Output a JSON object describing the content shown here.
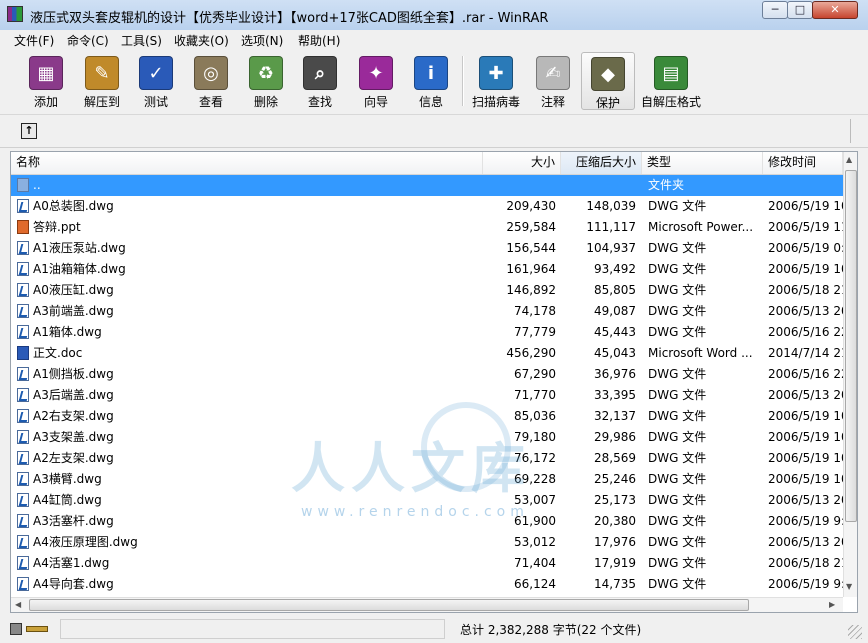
{
  "window": {
    "title": "液压式双头套皮辊机的设计【优秀毕业设计】【word+17张CAD图纸全套】.rar - WinRAR",
    "min_glyph": "─",
    "max_glyph": "□",
    "close_glyph": "✕"
  },
  "menu": [
    "文件(F)",
    "命令(C)",
    "工具(S)",
    "收藏夹(O)",
    "选项(N)",
    "帮助(H)"
  ],
  "toolbar": [
    {
      "label": "添加",
      "icon": "add-archive-icon",
      "glyph": "▦",
      "color": "#8a3a8a"
    },
    {
      "label": "解压到",
      "icon": "extract-to-icon",
      "glyph": "✎",
      "color": "#c08a2a"
    },
    {
      "label": "测试",
      "icon": "test-icon",
      "glyph": "✓",
      "color": "#2a5ab8"
    },
    {
      "label": "查看",
      "icon": "view-icon",
      "glyph": "◎",
      "color": "#8a7a5a"
    },
    {
      "label": "删除",
      "icon": "delete-icon",
      "glyph": "♻",
      "color": "#5a9a4a"
    },
    {
      "label": "查找",
      "icon": "find-icon",
      "glyph": "⌕",
      "color": "#4a4a4a"
    },
    {
      "label": "向导",
      "icon": "wizard-icon",
      "glyph": "✦",
      "color": "#9a2a9a"
    },
    {
      "label": "信息",
      "icon": "info-icon",
      "glyph": "i",
      "color": "#2a6ac8"
    },
    {
      "label": "扫描病毒",
      "icon": "scan-virus-icon",
      "glyph": "✚",
      "color": "#2a7ab8"
    },
    {
      "label": "注释",
      "icon": "comment-icon",
      "glyph": "✍",
      "color": "#b8b8b8"
    },
    {
      "label": "保护",
      "icon": "protect-icon",
      "glyph": "◆",
      "color": "#6a6a4a"
    },
    {
      "label": "自解压格式",
      "icon": "sfx-icon",
      "glyph": "▤",
      "color": "#3a8a3a"
    }
  ],
  "address": {
    "up_glyph": "↑"
  },
  "columns": {
    "name": "名称",
    "size": "大小",
    "packed": "压缩后大小",
    "type": "类型",
    "modified": "修改时间"
  },
  "files": [
    {
      "name": "..",
      "size": "",
      "packed": "",
      "type": "文件夹",
      "modified": "",
      "kind": "folder"
    },
    {
      "name": "A0总装图.dwg",
      "size": "209,430",
      "packed": "148,039",
      "type": "DWG 文件",
      "modified": "2006/5/19 10",
      "kind": "dwg"
    },
    {
      "name": "答辩.ppt",
      "size": "259,584",
      "packed": "111,117",
      "type": "Microsoft Power...",
      "modified": "2006/5/19 11",
      "kind": "ppt"
    },
    {
      "name": "A1液压泵站.dwg",
      "size": "156,544",
      "packed": "104,937",
      "type": "DWG 文件",
      "modified": "2006/5/19 0:",
      "kind": "dwg"
    },
    {
      "name": "A1油箱箱体.dwg",
      "size": "161,964",
      "packed": "93,492",
      "type": "DWG 文件",
      "modified": "2006/5/19 10",
      "kind": "dwg"
    },
    {
      "name": "A0液压缸.dwg",
      "size": "146,892",
      "packed": "85,805",
      "type": "DWG 文件",
      "modified": "2006/5/18 21",
      "kind": "dwg"
    },
    {
      "name": "A3前端盖.dwg",
      "size": "74,178",
      "packed": "49,087",
      "type": "DWG 文件",
      "modified": "2006/5/13 20",
      "kind": "dwg"
    },
    {
      "name": "A1箱体.dwg",
      "size": "77,779",
      "packed": "45,443",
      "type": "DWG 文件",
      "modified": "2006/5/16 22",
      "kind": "dwg"
    },
    {
      "name": "正文.doc",
      "size": "456,290",
      "packed": "45,043",
      "type": "Microsoft Word ...",
      "modified": "2014/7/14 21",
      "kind": "doc"
    },
    {
      "name": "A1侧挡板.dwg",
      "size": "67,290",
      "packed": "36,976",
      "type": "DWG 文件",
      "modified": "2006/5/16 22",
      "kind": "dwg"
    },
    {
      "name": "A3后端盖.dwg",
      "size": "71,770",
      "packed": "33,395",
      "type": "DWG 文件",
      "modified": "2006/5/13 20",
      "kind": "dwg"
    },
    {
      "name": "A2右支架.dwg",
      "size": "85,036",
      "packed": "32,137",
      "type": "DWG 文件",
      "modified": "2006/5/19 10",
      "kind": "dwg"
    },
    {
      "name": "A3支架盖.dwg",
      "size": "79,180",
      "packed": "29,986",
      "type": "DWG 文件",
      "modified": "2006/5/19 10",
      "kind": "dwg"
    },
    {
      "name": "A2左支架.dwg",
      "size": "76,172",
      "packed": "28,569",
      "type": "DWG 文件",
      "modified": "2006/5/19 10",
      "kind": "dwg"
    },
    {
      "name": "A3横臂.dwg",
      "size": "69,228",
      "packed": "25,246",
      "type": "DWG 文件",
      "modified": "2006/5/19 10",
      "kind": "dwg"
    },
    {
      "name": "A4缸筒.dwg",
      "size": "53,007",
      "packed": "25,173",
      "type": "DWG 文件",
      "modified": "2006/5/13 20",
      "kind": "dwg"
    },
    {
      "name": "A3活塞杆.dwg",
      "size": "61,900",
      "packed": "20,380",
      "type": "DWG 文件",
      "modified": "2006/5/19 9:",
      "kind": "dwg"
    },
    {
      "name": "A4液压原理图.dwg",
      "size": "53,012",
      "packed": "17,976",
      "type": "DWG 文件",
      "modified": "2006/5/13 20",
      "kind": "dwg"
    },
    {
      "name": "A4活塞1.dwg",
      "size": "71,404",
      "packed": "17,919",
      "type": "DWG 文件",
      "modified": "2006/5/18 21",
      "kind": "dwg"
    },
    {
      "name": "A4导向套.dwg",
      "size": "66,124",
      "packed": "14,735",
      "type": "DWG 文件",
      "modified": "2006/5/19 9:",
      "kind": "dwg"
    }
  ],
  "status": {
    "summary": "总计 2,382,288 字节(22 个文件)"
  },
  "watermark": {
    "logo_text": "人人文库",
    "url": "www.renrendoc.com"
  }
}
